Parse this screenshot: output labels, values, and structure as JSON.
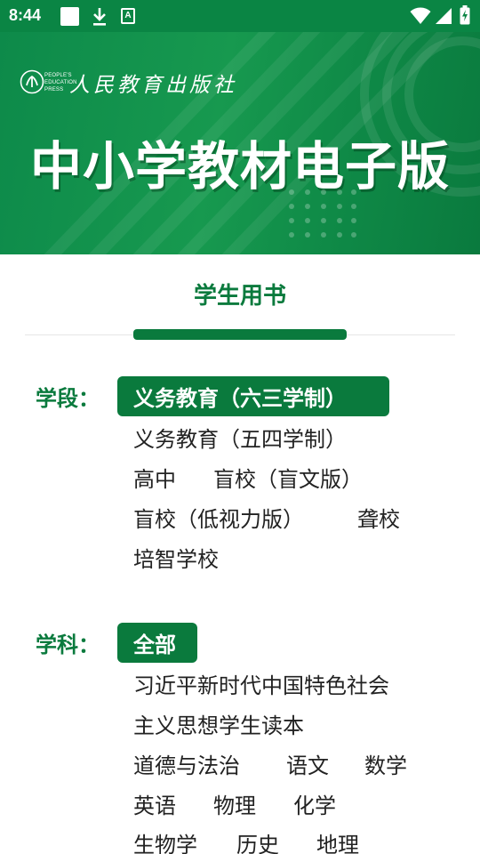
{
  "status_bar": {
    "time": "8:44",
    "icons": [
      "notification-square-icon",
      "download-icon",
      "a-text-icon",
      "wifi-icon",
      "signal-icon",
      "battery-charging-icon"
    ],
    "a_glyph": "A"
  },
  "banner": {
    "publisher_en_line1": "PEOPLE'S",
    "publisher_en_line2": "EDUCATION",
    "publisher_en_line3": "PRESS",
    "publisher_cn": "人民教育出版社",
    "title": "中小学教材电子版"
  },
  "section": {
    "title": "学生用书"
  },
  "stage": {
    "label": "学段：",
    "selected": "义务教育（六三学制）",
    "options": [
      "义务教育（五四学制）",
      "高中",
      "盲校（盲文版）",
      "盲校（低视力版）",
      "聋校",
      "培智学校"
    ]
  },
  "subject": {
    "label": "学科：",
    "selected": "全部",
    "options": [
      "习近平新时代中国特色社会",
      "主义思想学生读本",
      "道德与法治",
      "语文",
      "数学",
      "英语",
      "物理",
      "化学",
      "生物学",
      "历史",
      "地理"
    ]
  },
  "colors": {
    "brand_green": "#0a7a3d",
    "banner_green": "#0d8a4a",
    "text": "#222222"
  }
}
